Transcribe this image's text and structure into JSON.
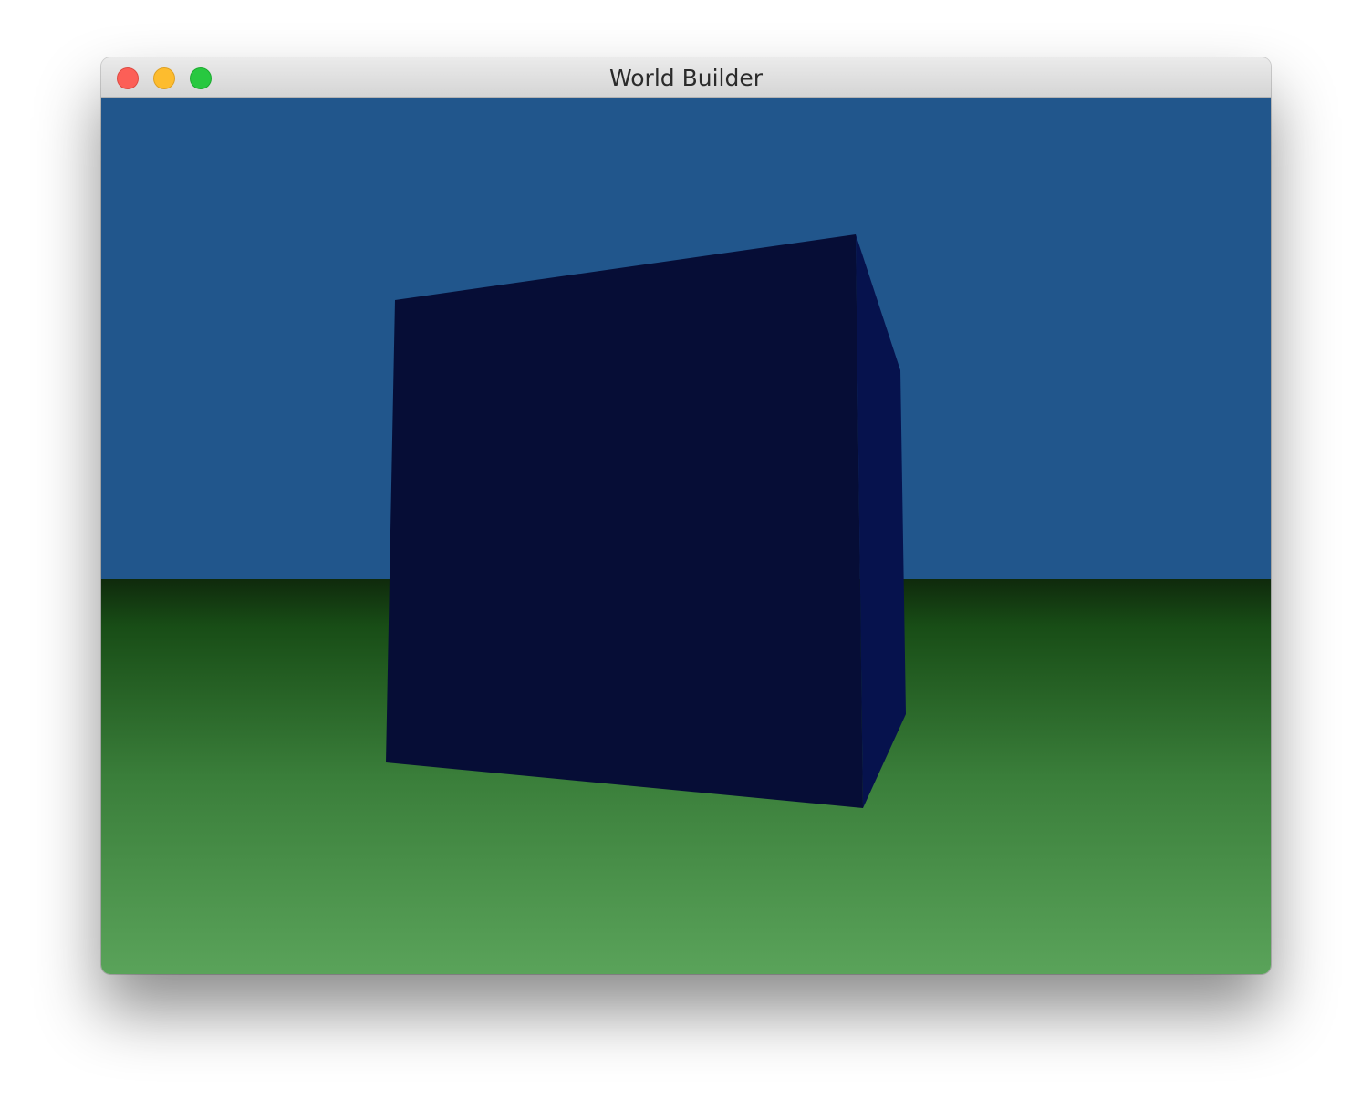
{
  "window": {
    "title": "World Builder",
    "controls": {
      "close": "close-button",
      "minimize": "minimize-button",
      "zoom": "zoom-button"
    }
  },
  "scene": {
    "sky_color": "#21568c",
    "ground_colors": [
      "#0f2a0c",
      "#184d16",
      "#3a7e3a",
      "#5aa35a"
    ],
    "cube_front_color": "#060d36",
    "cube_side_color": "#06124d"
  }
}
